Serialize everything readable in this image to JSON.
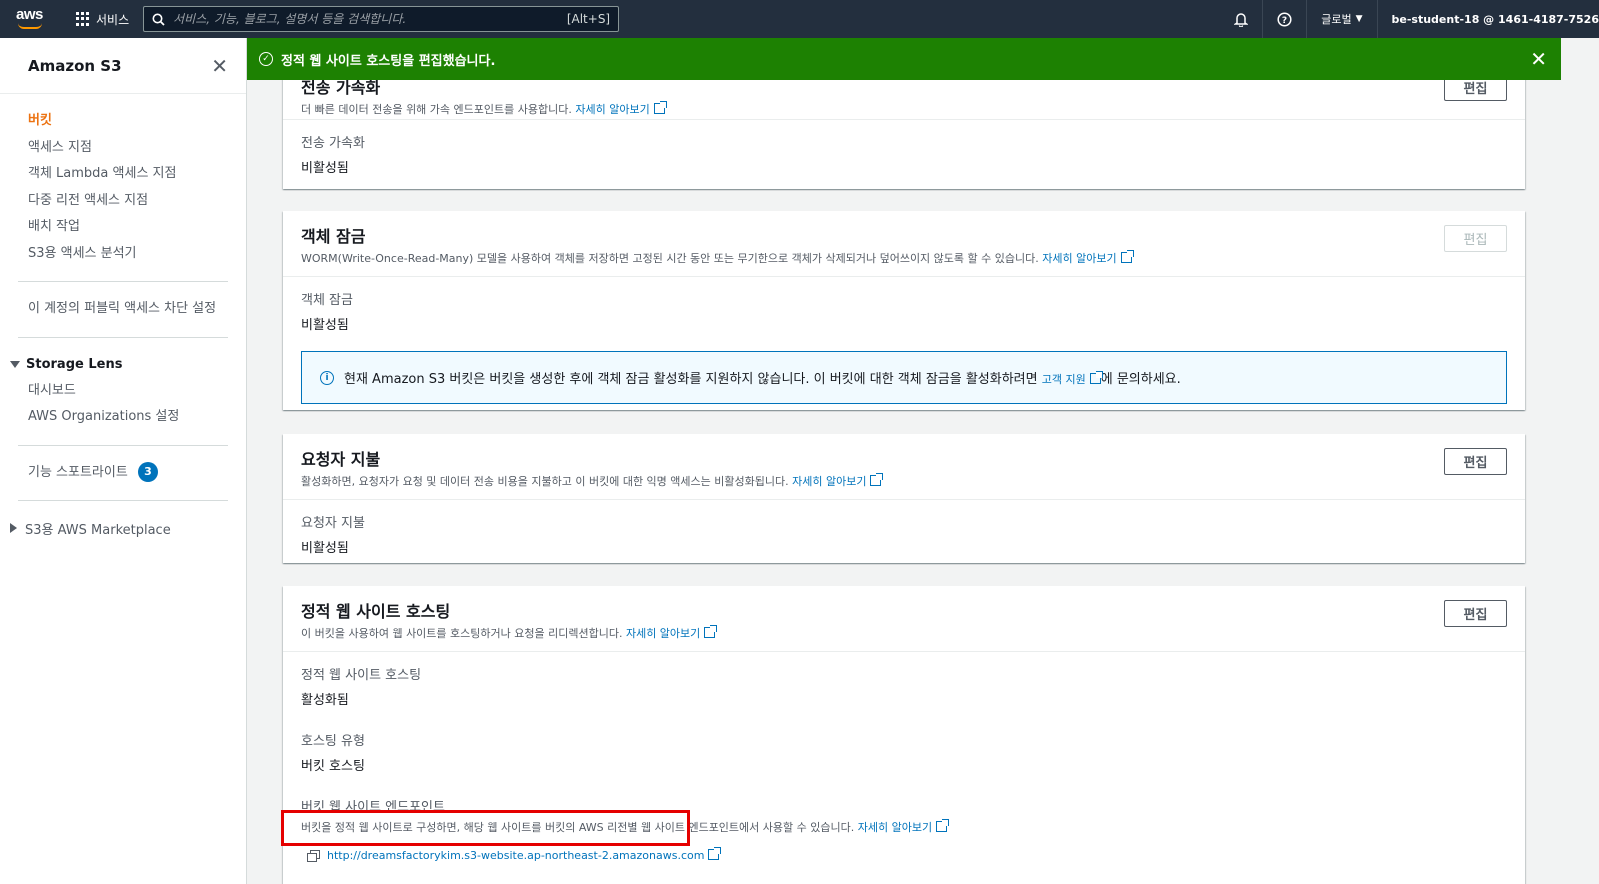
{
  "topnav": {
    "logo": "aws",
    "services_label": "서비스",
    "search_placeholder": "서비스, 기능, 블로그, 설명서 등을 검색합니다.",
    "search_shortcut": "[Alt+S]",
    "region_label": "글로벌",
    "user_label": "be-student-18 @ 1461-4187-7526"
  },
  "sidebar": {
    "title": "Amazon S3",
    "items": [
      {
        "label": "버킷"
      },
      {
        "label": "액세스 지점"
      },
      {
        "label": "객체 Lambda 액세스 지점"
      },
      {
        "label": "다중 리전 액세스 지점"
      },
      {
        "label": "배치 작업"
      },
      {
        "label": "S3용 액세스 분석기"
      }
    ],
    "block_public": "이 계정의 퍼블릭 액세스 차단 설정",
    "storage_lens": {
      "title": "Storage Lens",
      "items": [
        {
          "label": "대시보드"
        },
        {
          "label": "AWS Organizations 설정"
        }
      ]
    },
    "spotlight_label": "기능 스포트라이트",
    "spotlight_count": "3",
    "marketplace": "S3용 AWS Marketplace"
  },
  "flash": {
    "message": "정적 웹 사이트 호스팅을 편집했습니다."
  },
  "sections": {
    "transfer": {
      "title": "전송 가속화",
      "desc": "더 빠른 데이터 전송을 위해 가속 엔드포인트를 사용합니다.",
      "learn_more": "자세히 알아보기",
      "edit": "편집",
      "field_label": "전송 가속화",
      "field_value": "비활성됨"
    },
    "object_lock": {
      "title": "객체 잠금",
      "desc": "WORM(Write-Once-Read-Many) 모델을 사용하여 객체를 저장하면 고정된 시간 동안 또는 무기한으로 객체가 삭제되거나 덮어쓰이지 않도록 할 수 있습니다.",
      "learn_more": "자세히 알아보기",
      "edit": "편집",
      "field_label": "객체 잠금",
      "field_value": "비활성됨",
      "info_prefix": "현재 Amazon S3 버킷은 버킷을 생성한 후에 객체 잠금 활성화를 지원하지 않습니다. 이 버킷에 대한 객체 잠금을 활성화하려면",
      "info_link": "고객 지원",
      "info_suffix": "에 문의하세요."
    },
    "requester_pays": {
      "title": "요청자 지불",
      "desc": "활성화하면, 요청자가 요청 및 데이터 전송 비용을 지불하고 이 버킷에 대한 익명 액세스는 비활성화됩니다.",
      "learn_more": "자세히 알아보기",
      "edit": "편집",
      "field_label": "요청자 지불",
      "field_value": "비활성됨"
    },
    "static_hosting": {
      "title": "정적 웹 사이트 호스팅",
      "desc": "이 버킷을 사용하여 웹 사이트를 호스팅하거나 요청을 리디렉션합니다.",
      "learn_more": "자세히 알아보기",
      "edit": "편집",
      "hosting_label": "정적 웹 사이트 호스팅",
      "hosting_value": "활성화됨",
      "type_label": "호스팅 유형",
      "type_value": "버킷 호스팅",
      "endpoint_label": "버킷 웹 사이트 엔드포인트",
      "endpoint_desc": "버킷을 정적 웹 사이트로 구성하면, 해당 웹 사이트를 버킷의 AWS 리전별 웹 사이트 엔드포인트에서 사용할 수 있습니다.",
      "endpoint_learn_more": "자세히 알아보기",
      "endpoint_url": "http://dreamsfactorykim.s3-website.ap-northeast-2.amazonaws.com"
    }
  },
  "colors": {
    "nav_bg": "#232f3e",
    "flash_bg": "#1d8102",
    "active_nav": "#ec7211",
    "link": "#0073bb",
    "highlight": "#e50000"
  }
}
